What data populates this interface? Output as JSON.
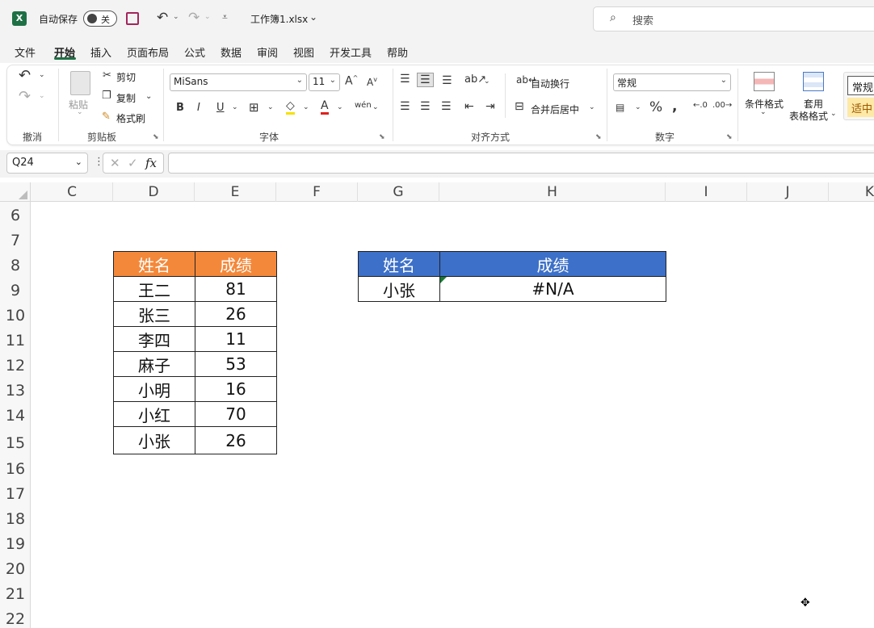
{
  "app": {
    "autosave_label": "自动保存",
    "autosave_state": "关",
    "filename": "工作簿1.xlsx",
    "search_placeholder": "搜索"
  },
  "menu_tabs": [
    "文件",
    "开始",
    "插入",
    "页面布局",
    "公式",
    "数据",
    "审阅",
    "视图",
    "开发工具",
    "帮助"
  ],
  "active_tab": "开始",
  "ribbon": {
    "undo_group": "撤消",
    "clipboard": {
      "paste": "粘贴",
      "cut": "剪切",
      "copy": "复制",
      "format_painter": "格式刷",
      "label": "剪贴板"
    },
    "font": {
      "name": "MiSans",
      "size": "11",
      "label": "字体"
    },
    "alignment": {
      "wrap_text": "自动换行",
      "merge_center": "合并后居中",
      "label": "对齐方式"
    },
    "number": {
      "format": "常规",
      "label": "数字"
    },
    "styles": {
      "conditional": "条件格式",
      "table_format_1": "套用",
      "table_format_2": "表格格式",
      "style_normal": "常规",
      "style_neutral": "适中"
    }
  },
  "formula_bar": {
    "name_box": "Q24",
    "formula": ""
  },
  "grid": {
    "columns": [
      "C",
      "D",
      "E",
      "F",
      "G",
      "H",
      "I",
      "J",
      "K"
    ],
    "rows": [
      "6",
      "7",
      "8",
      "9",
      "10",
      "11",
      "12",
      "13",
      "14",
      "15",
      "16",
      "17",
      "18",
      "19",
      "20",
      "21",
      "22"
    ]
  },
  "table_left": {
    "header": [
      "姓名",
      "成绩"
    ],
    "rows": [
      [
        "王二",
        "81"
      ],
      [
        "张三",
        "26"
      ],
      [
        "李四",
        "11"
      ],
      [
        "麻子",
        "53"
      ],
      [
        "小明",
        "16"
      ],
      [
        "小红",
        "70"
      ],
      [
        "小张",
        "26"
      ]
    ]
  },
  "table_right": {
    "header": [
      "姓名",
      "成绩"
    ],
    "rows": [
      [
        "小张",
        "#N/A"
      ]
    ]
  },
  "colors": {
    "accent": "#1e7145",
    "header_orange": "#f4883a",
    "header_blue": "#3d70c8",
    "error_triangle": "#1a7a35"
  }
}
